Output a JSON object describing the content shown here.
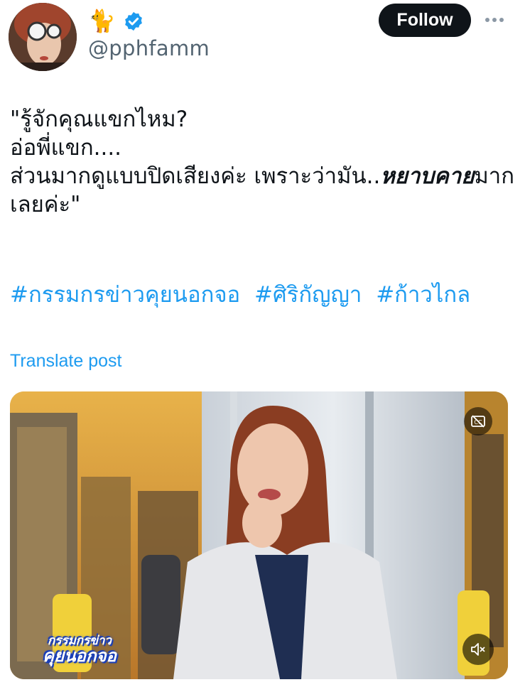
{
  "author": {
    "name_emoji": "🐈",
    "handle": "@pphfamm",
    "verified": true
  },
  "header": {
    "follow_label": "Follow",
    "more_icon": "ellipsis-icon"
  },
  "tweet": {
    "lines": [
      "\"รู้จักคุณแขกไหม?",
      "อ่อพี่แขก....",
      "ส่วนมากดูแบบปิดเสียงค่ะ เพราะว่ามัน.."
    ],
    "emphasis_1": "หยาบคาย",
    "tail": "มากเลยค่ะ\"",
    "hashtags": [
      "#กรรมกรข่าวคุยนอกจอ",
      "#ศิริกัญญา",
      "#ก้าวไกล"
    ]
  },
  "translate_label": "Translate post",
  "media": {
    "show_logo_line1": "กรรมกรข่าว",
    "show_logo_line2": "คุยนอกจอ",
    "cc_icon": "closed-captions-off-icon",
    "mute_icon": "speaker-muted-icon",
    "colors": {
      "backdrop": "#cf9a3a",
      "blazer": "#e6e7ea",
      "hair": "#8a3d22"
    }
  }
}
